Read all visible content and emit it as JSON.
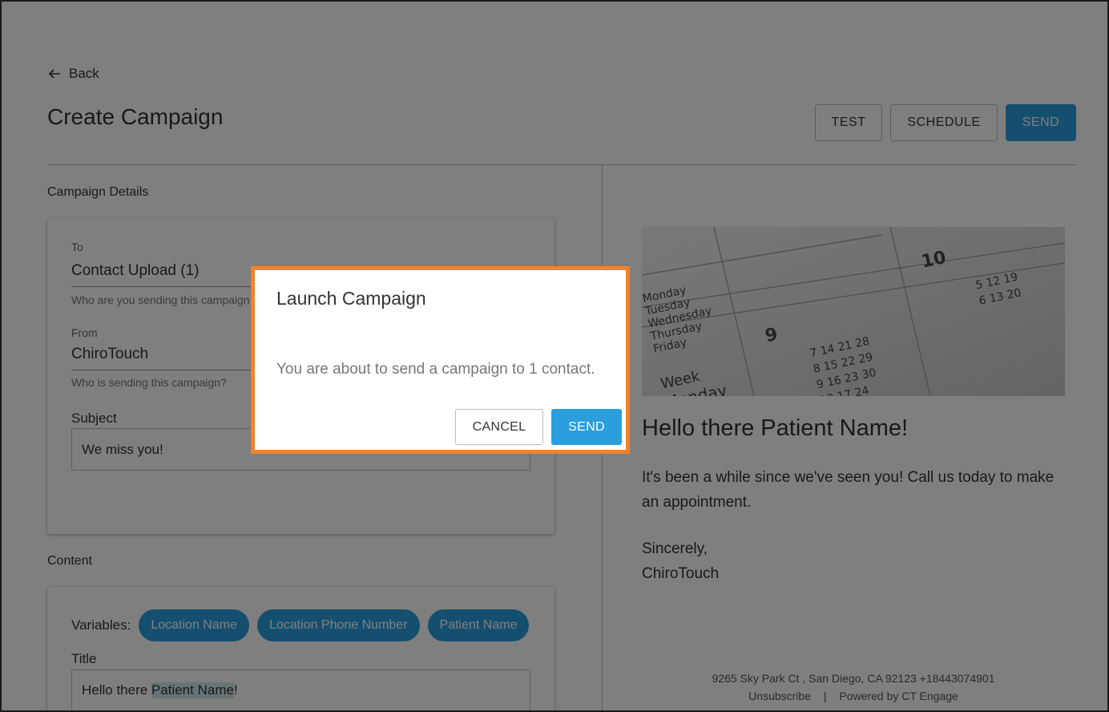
{
  "header": {
    "back_label": "Back",
    "page_title": "Create Campaign",
    "test_label": "TEST",
    "schedule_label": "SCHEDULE",
    "send_label": "SEND"
  },
  "details": {
    "section_label": "Campaign Details",
    "to_label": "To",
    "to_value": "Contact Upload (1)",
    "to_help": "Who are you sending this campaign to?",
    "from_label": "From",
    "from_value": "ChiroTouch",
    "from_help": "Who is sending this campaign?",
    "subject_label": "Subject",
    "subject_value": "We miss you!"
  },
  "content": {
    "section_label": "Content",
    "variables_label": "Variables:",
    "variables": [
      "Location Name",
      "Location Phone Number",
      "Patient Name"
    ],
    "title_label": "Title",
    "title_prefix": "Hello there ",
    "title_variable": "Patient Name",
    "title_suffix": "!"
  },
  "preview": {
    "image_alt": "calendar-photo",
    "heading": "Hello there Patient Name!",
    "body": "It's been a while since we've seen you! Call us today to make an appointment.",
    "signoff": "Sincerely,",
    "signature": "ChiroTouch",
    "footer_address": "9265 Sky Park Ct , San Diego, CA 92123 +18443074901",
    "unsubscribe": "Unsubscribe",
    "separator": "|",
    "powered_by": "Powered by CT Engage"
  },
  "modal": {
    "title": "Launch Campaign",
    "message": "You are about to send a campaign to 1 contact.",
    "cancel_label": "CANCEL",
    "send_label": "SEND"
  },
  "colors": {
    "primary": "#2b9ede",
    "modal_border": "#f5822a",
    "highlight": "#cde8ee"
  }
}
